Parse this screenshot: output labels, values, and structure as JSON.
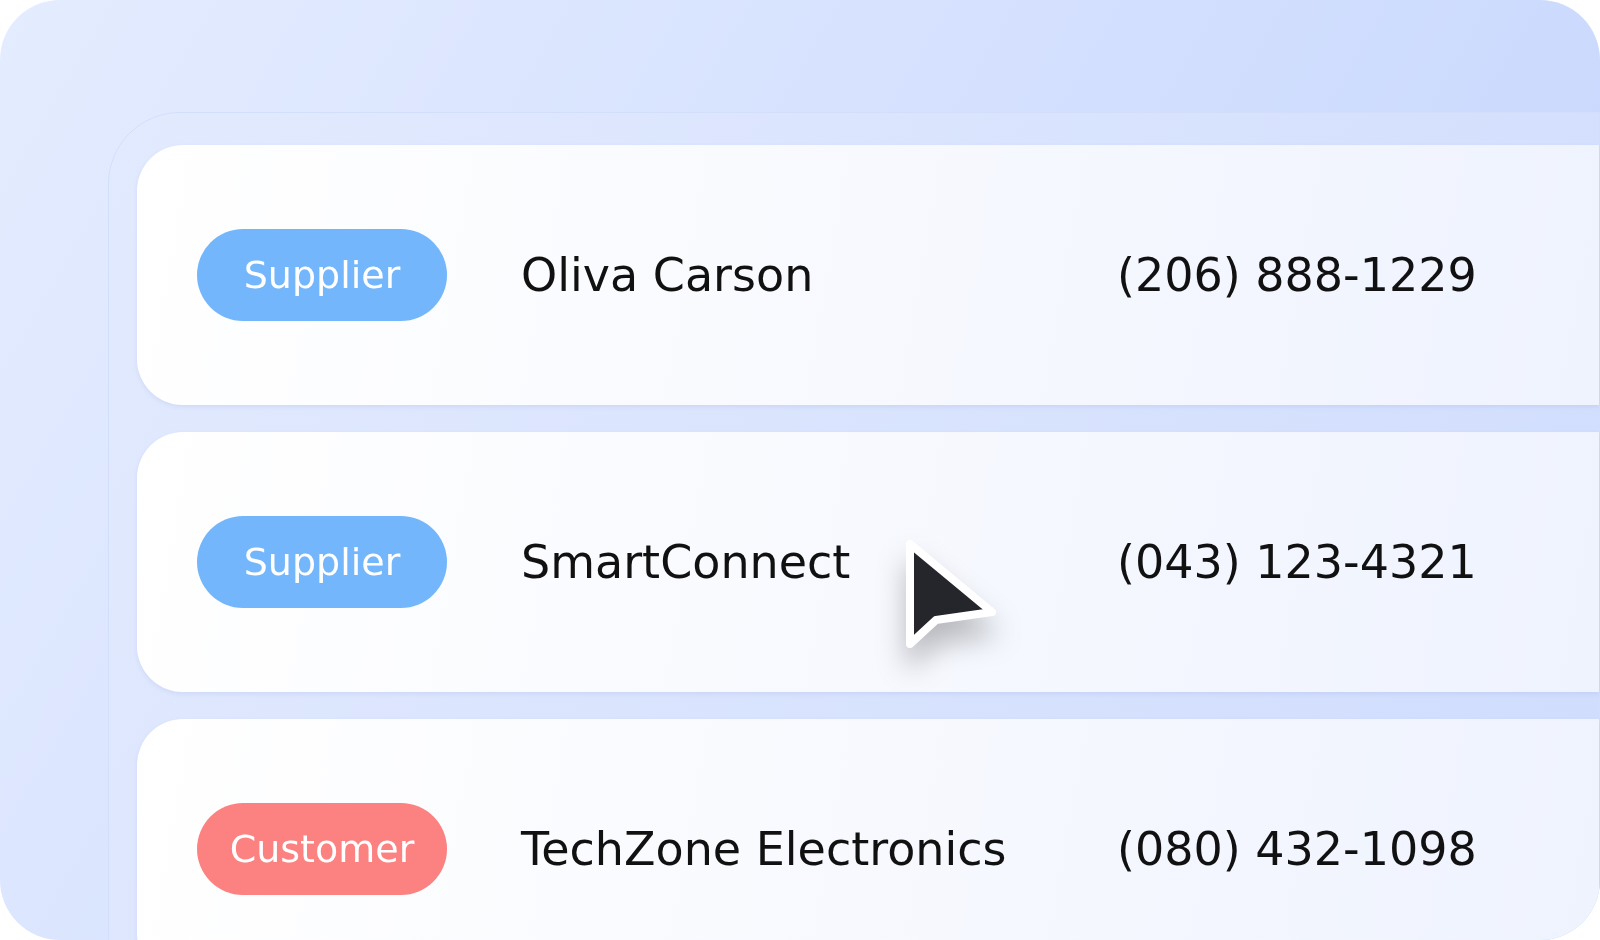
{
  "contacts": [
    {
      "tag": {
        "label": "Supplier",
        "color": "#74b6fb"
      },
      "name": "Oliva Carson",
      "phone": "(206) 888-1229"
    },
    {
      "tag": {
        "label": "Supplier",
        "color": "#74b6fb"
      },
      "name": "SmartConnect",
      "phone": "(043) 123-4321"
    },
    {
      "tag": {
        "label": "Customer",
        "color": "#fc8181"
      },
      "name": "TechZone Electronics",
      "phone": "(080) 432-1098"
    }
  ]
}
